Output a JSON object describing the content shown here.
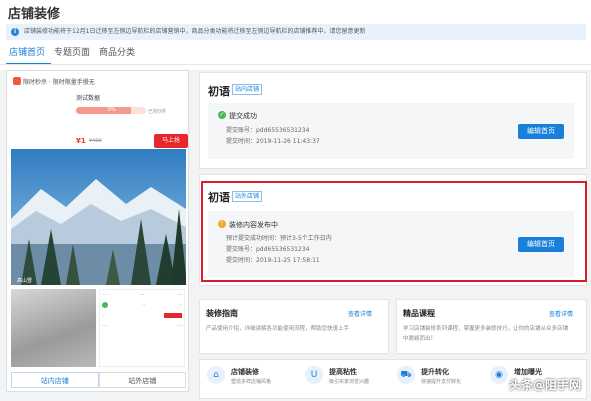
{
  "page": {
    "title": "店铺装修",
    "notice": "店铺装修功能将于12月1日迁移至左侧边导航栏的店铺营销中，商品分类功能将迁移至左侧边导航栏的店铺推荐中，请您留意更新",
    "tabs": [
      "店铺首页",
      "专题页面",
      "商品分类"
    ],
    "active_tab": 0
  },
  "preview": {
    "flash_tag": "限时秒杀 · 限时限量手慢无",
    "product_name": "测试数据",
    "progress_label": "0%",
    "progress": 0.78,
    "sold_label": "已抢0件",
    "price": "¥1",
    "orig_price": "¥400",
    "buy_label": "马上抢",
    "banner_caption": "高山雪",
    "tabs": [
      "站内店铺",
      "站外店铺"
    ]
  },
  "cards": [
    {
      "title": "初语",
      "badge": "站内店铺",
      "status": "提交成功",
      "status_color": "#49b85a",
      "lines": [
        "提交账号：pdd65536531234",
        "提交时间：2019-11-26 11:43:37"
      ],
      "button": "编辑首页"
    },
    {
      "title": "初语",
      "badge": "站外店铺",
      "status": "装修内容发布中",
      "status_color": "#f5a623",
      "lines": [
        "预计提交成功时间：预计3-5个工作日内",
        "提交账号：pdd65536531234",
        "提交时间：2019-11-25 17:58:11"
      ],
      "button": "编辑首页"
    }
  ],
  "info": [
    {
      "title": "装修指南",
      "link": "查看详情",
      "desc": "产品使用介绍，详细讲解各功能使用流程，帮助您快速上手"
    },
    {
      "title": "精品课程",
      "link": "查看详情",
      "desc": "学习店铺装修系列课程，掌握更多装修技巧，让你的店铺从众多店铺中脱颖而出！"
    }
  ],
  "features": [
    {
      "name": "店铺装修",
      "desc": "塑造多样店铺风格",
      "icon": "store-icon"
    },
    {
      "name": "提高粘性",
      "desc": "吸引买家浏览兴趣",
      "icon": "magnet-icon"
    },
    {
      "name": "提升转化",
      "desc": "快速提升支付转化",
      "icon": "cart-icon"
    },
    {
      "name": "增加曝光",
      "desc": "",
      "icon": "eye-icon"
    }
  ],
  "watermark": "头条@阻手网"
}
